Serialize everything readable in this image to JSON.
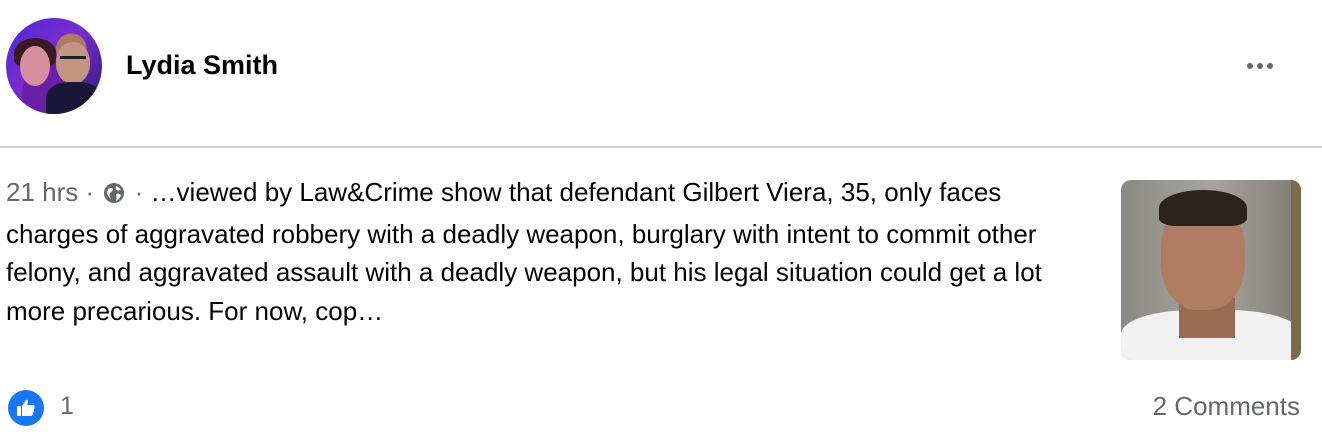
{
  "post": {
    "author": "Lydia Smith",
    "timestamp": "21 hrs",
    "separator": "·",
    "audience_icon": "globe-icon",
    "text": "…viewed by Law&Crime show that defendant Gilbert Viera, 35, only faces charges of aggravated robbery with a deadly weapon, burglary with intent to commit other felony, and aggravated assault with a deadly weapon, but his legal situation could get a lot more precarious. For now, cop…",
    "menu_icon": "more-options-icon"
  },
  "footer": {
    "like_icon": "thumbs-up-icon",
    "like_count": "1",
    "comments_label": "2 Comments"
  },
  "colors": {
    "primary_text": "#050505",
    "secondary_text": "#65676b",
    "like_blue": "#1877f2",
    "divider": "#ced0d4"
  }
}
